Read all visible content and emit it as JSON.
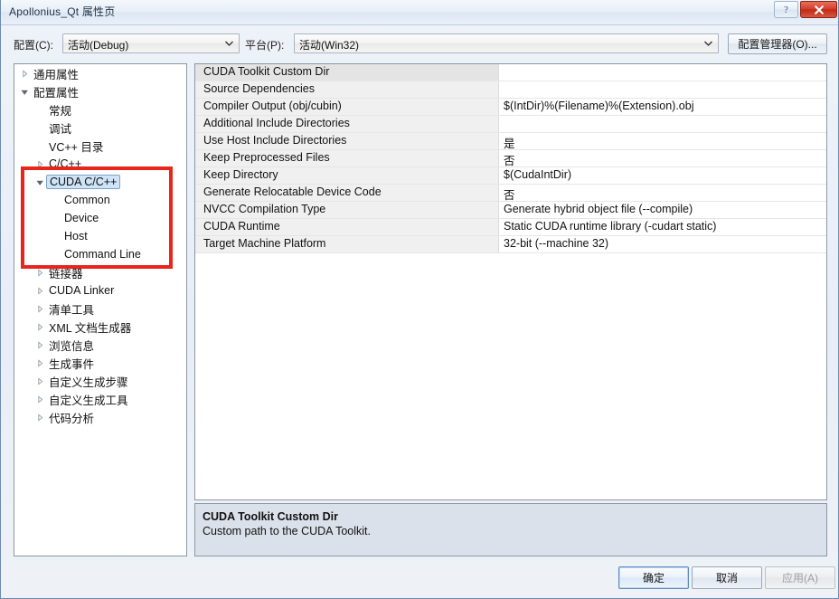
{
  "window": {
    "title": "Apollonius_Qt 属性页",
    "help_button": "?",
    "close_button": "✕",
    "accent_color": "#e8251b",
    "selection_color": "#cfe4f7"
  },
  "config_bar": {
    "config_label": "配置(C):",
    "config_value": "活动(Debug)",
    "platform_label": "平台(P):",
    "platform_value": "活动(Win32)",
    "config_manager_button": "配置管理器(O)..."
  },
  "tree": {
    "items": [
      {
        "label": "通用属性",
        "indent": 0,
        "arrow": "collapsed",
        "selected": false
      },
      {
        "label": "配置属性",
        "indent": 0,
        "arrow": "expanded",
        "selected": false
      },
      {
        "label": "常规",
        "indent": 1,
        "arrow": "none",
        "selected": false
      },
      {
        "label": "调试",
        "indent": 1,
        "arrow": "none",
        "selected": false
      },
      {
        "label": "VC++ 目录",
        "indent": 1,
        "arrow": "none",
        "selected": false
      },
      {
        "label": "C/C++",
        "indent": 1,
        "arrow": "collapsed",
        "selected": false
      },
      {
        "label": "CUDA C/C++",
        "indent": 1,
        "arrow": "expanded",
        "selected": true
      },
      {
        "label": "Common",
        "indent": 2,
        "arrow": "none",
        "selected": false
      },
      {
        "label": "Device",
        "indent": 2,
        "arrow": "none",
        "selected": false
      },
      {
        "label": "Host",
        "indent": 2,
        "arrow": "none",
        "selected": false
      },
      {
        "label": "Command Line",
        "indent": 2,
        "arrow": "none",
        "selected": false
      },
      {
        "label": "链接器",
        "indent": 1,
        "arrow": "collapsed",
        "selected": false
      },
      {
        "label": "CUDA Linker",
        "indent": 1,
        "arrow": "collapsed",
        "selected": false
      },
      {
        "label": "清单工具",
        "indent": 1,
        "arrow": "collapsed",
        "selected": false
      },
      {
        "label": "XML 文档生成器",
        "indent": 1,
        "arrow": "collapsed",
        "selected": false
      },
      {
        "label": "浏览信息",
        "indent": 1,
        "arrow": "collapsed",
        "selected": false
      },
      {
        "label": "生成事件",
        "indent": 1,
        "arrow": "collapsed",
        "selected": false
      },
      {
        "label": "自定义生成步骤",
        "indent": 1,
        "arrow": "collapsed",
        "selected": false
      },
      {
        "label": "自定义生成工具",
        "indent": 1,
        "arrow": "collapsed",
        "selected": false
      },
      {
        "label": "代码分析",
        "indent": 1,
        "arrow": "collapsed",
        "selected": false
      }
    ]
  },
  "properties": {
    "rows": [
      {
        "name": "CUDA Toolkit Custom Dir",
        "value": "",
        "selected": true
      },
      {
        "name": "Source Dependencies",
        "value": "",
        "selected": false
      },
      {
        "name": "Compiler Output (obj/cubin)",
        "value": "$(IntDir)%(Filename)%(Extension).obj",
        "selected": false
      },
      {
        "name": "Additional Include Directories",
        "value": "",
        "selected": false
      },
      {
        "name": "Use Host Include Directories",
        "value": "是",
        "selected": false
      },
      {
        "name": "Keep Preprocessed Files",
        "value": "否",
        "selected": false
      },
      {
        "name": "Keep Directory",
        "value": "$(CudaIntDir)",
        "selected": false
      },
      {
        "name": "Generate Relocatable Device Code",
        "value": "否",
        "selected": false
      },
      {
        "name": "NVCC Compilation Type",
        "value": "Generate hybrid object file (--compile)",
        "selected": false
      },
      {
        "name": "CUDA Runtime",
        "value": "Static CUDA runtime library (-cudart static)",
        "selected": false
      },
      {
        "name": "Target Machine Platform",
        "value": "32-bit (--machine 32)",
        "selected": false
      }
    ]
  },
  "description": {
    "title": "CUDA Toolkit Custom Dir",
    "body": "Custom path to the CUDA Toolkit."
  },
  "footer": {
    "ok": "确定",
    "cancel": "取消",
    "apply": "应用(A)"
  }
}
